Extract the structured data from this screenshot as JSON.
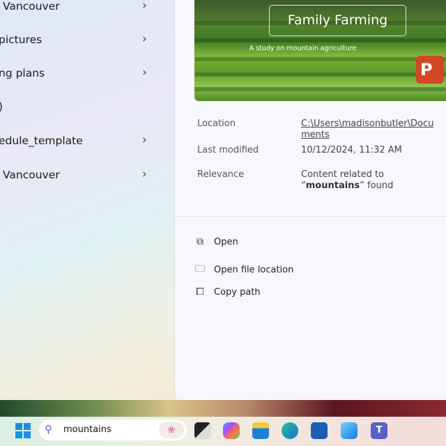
{
  "results": [
    {
      "label": "Vancouver",
      "chevron": true
    },
    {
      "label": "pictures",
      "chevron": true
    },
    {
      "label": "ng plans",
      "chevron": true
    },
    {
      "label": ")",
      "chevron": false
    },
    {
      "label": "edule_template",
      "chevron": true
    },
    {
      "label": "Vancouver",
      "chevron": true
    }
  ],
  "preview": {
    "title": "Family Farming",
    "subtitle": "A study on mountain agriculture",
    "app_badge": "P",
    "location_label": "Location",
    "location_value": "C:\\Users\\madisonbutler\\Documents",
    "modified_label": "Last modified",
    "modified_value": "10/12/2024, 11:32 AM",
    "relevance_label": "Relevance",
    "relevance_prefix": "Content related to “",
    "relevance_term": "mountains",
    "relevance_suffix": "” found"
  },
  "actions": [
    {
      "label": "Open",
      "icon": "open-external-icon"
    },
    {
      "label": "Open file location",
      "icon": "folder-icon"
    },
    {
      "label": "Copy path",
      "icon": "copy-icon"
    }
  ],
  "taskbar": {
    "search_query": "mountains"
  }
}
